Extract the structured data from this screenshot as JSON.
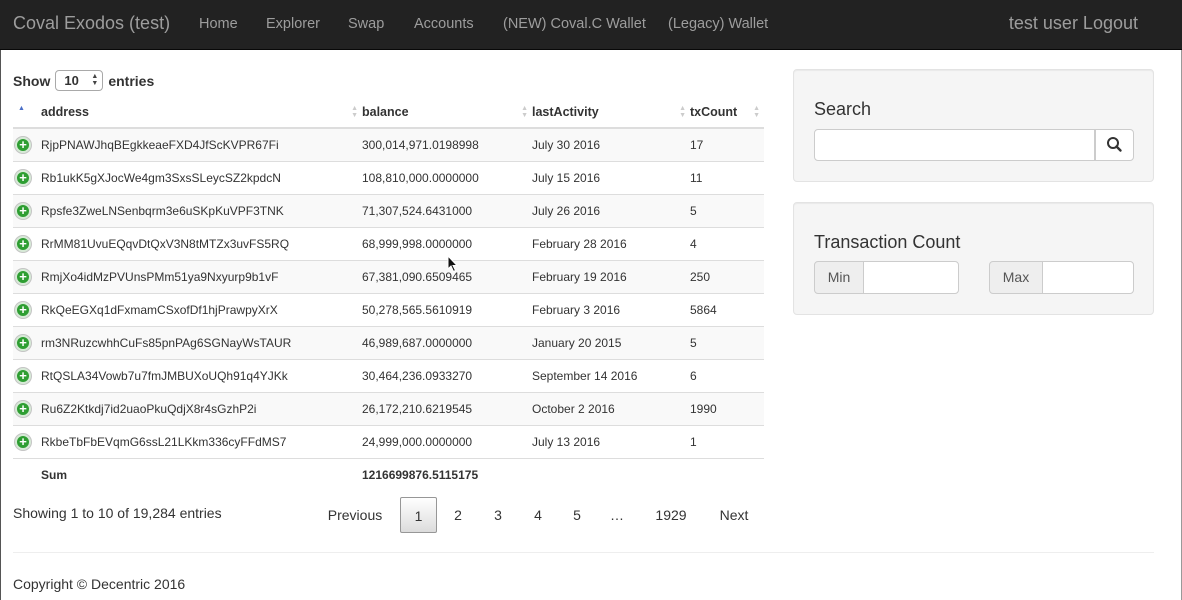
{
  "navbar": {
    "brand": "Coval Exodos (test)",
    "links": [
      "Home",
      "Explorer",
      "Swap",
      "Accounts",
      "(NEW) Coval.C Wallet",
      "(Legacy) Wallet"
    ],
    "user": "test user Logout"
  },
  "table_controls": {
    "show_label": "Show",
    "entries_label": "entries",
    "page_length": "10"
  },
  "table": {
    "columns": [
      "address",
      "balance",
      "lastActivity",
      "txCount"
    ],
    "rows": [
      {
        "address": "RjpPNAWJhqBEgkkeaeFXD4JfScKVPR67Fi",
        "balance": "300,014,971.0198998",
        "lastActivity": "July 30 2016",
        "txCount": "17"
      },
      {
        "address": "Rb1ukK5gXJocWe4gm3SxsSLeycSZ2kpdcN",
        "balance": "108,810,000.0000000",
        "lastActivity": "July 15 2016",
        "txCount": "11"
      },
      {
        "address": "Rpsfe3ZweLNSenbqrm3e6uSKpKuVPF3TNK",
        "balance": "71,307,524.6431000",
        "lastActivity": "July 26 2016",
        "txCount": "5"
      },
      {
        "address": "RrMM81UvuEQqvDtQxV3N8tMTZx3uvFS5RQ",
        "balance": "68,999,998.0000000",
        "lastActivity": "February 28 2016",
        "txCount": "4"
      },
      {
        "address": "RmjXo4idMzPVUnsPMm51ya9Nxyurp9b1vF",
        "balance": "67,381,090.6509465",
        "lastActivity": "February 19 2016",
        "txCount": "250"
      },
      {
        "address": "RkQeEGXq1dFxmamCSxofDf1hjPrawpyXrX",
        "balance": "50,278,565.5610919",
        "lastActivity": "February 3 2016",
        "txCount": "5864"
      },
      {
        "address": "rm3NRuzcwhhCuFs85pnPAg6SGNayWsTAUR",
        "balance": "46,989,687.0000000",
        "lastActivity": "January 20 2015",
        "txCount": "5"
      },
      {
        "address": "RtQSLA34Vowb7u7fmJMBUXoUQh91q4YJKk",
        "balance": "30,464,236.0933270",
        "lastActivity": "September 14 2016",
        "txCount": "6"
      },
      {
        "address": "Ru6Z2Ktkdj7id2uaoPkuQdjX8r4sGzhP2i",
        "balance": "26,172,210.6219545",
        "lastActivity": "October 2 2016",
        "txCount": "1990"
      },
      {
        "address": "RkbeTbFbEVqmG6ssL21LKkm336cyFFdMS7",
        "balance": "24,999,000.0000000",
        "lastActivity": "July 13 2016",
        "txCount": "1"
      }
    ],
    "footer": {
      "label": "Sum",
      "balance_sum": "1216699876.5115175"
    }
  },
  "table_info": "Showing 1 to 10 of 19,284 entries",
  "pagination": {
    "previous": "Previous",
    "pages": [
      "1",
      "2",
      "3",
      "4",
      "5",
      "…",
      "1929"
    ],
    "current": "1",
    "next": "Next"
  },
  "search_panel": {
    "title": "Search",
    "input_value": ""
  },
  "tx_count_panel": {
    "title": "Transaction Count",
    "min_label": "Min",
    "max_label": "Max"
  },
  "footer": {
    "copyright": "Copyright © Decentric 2016"
  },
  "icons": {
    "expand": "plus-circle-icon",
    "search": "magnifier-icon",
    "sort": "sort-arrows-icon"
  },
  "colors": {
    "navbar_bg": "#222222",
    "nav_text": "#9d9d9d",
    "expand_icon": "#2e9e32",
    "sort_active": "#4a6ec7"
  }
}
